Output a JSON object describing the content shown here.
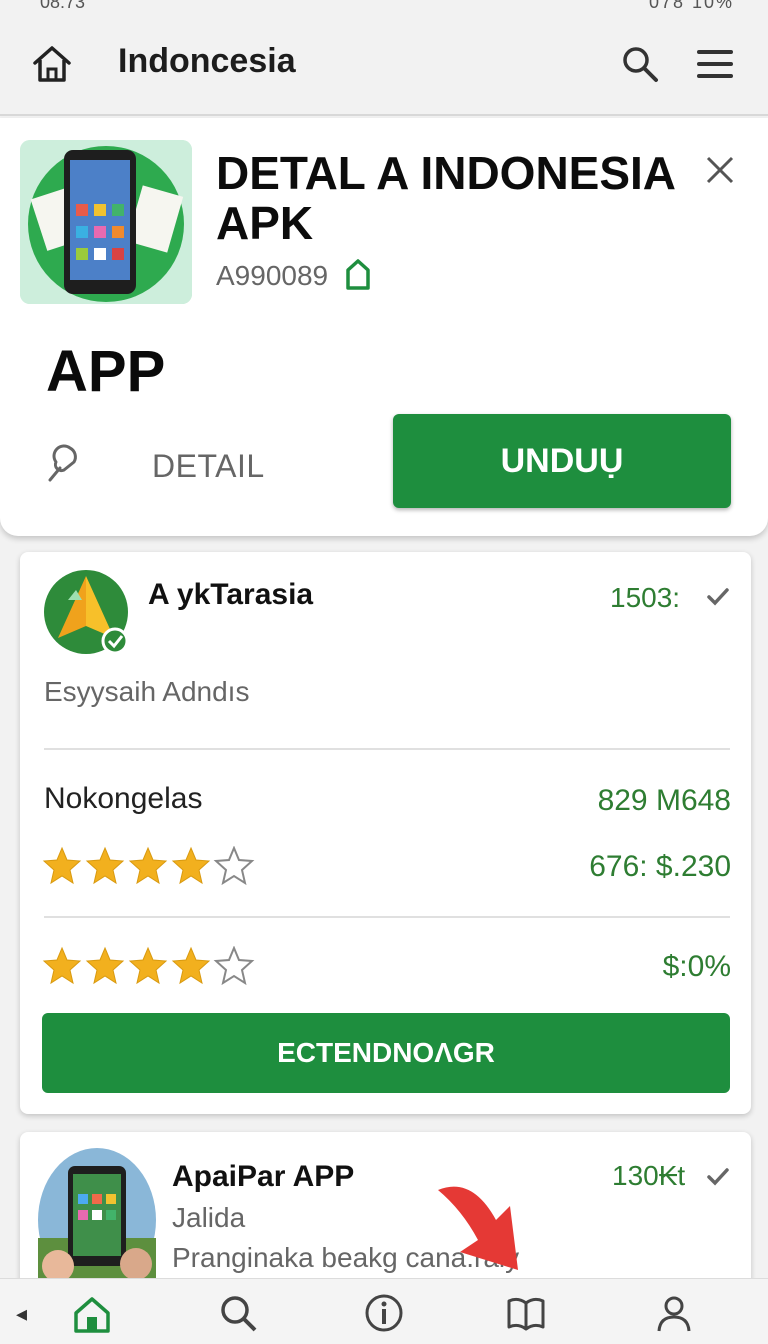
{
  "status": {
    "left": "08:73",
    "right": "078  10%"
  },
  "appbar": {
    "title": "Indoncesia"
  },
  "hero": {
    "app_name": "DETAL A INDONESIA APK",
    "code": "A990089",
    "app_label": "APP",
    "detail_label": "DETAIL",
    "download_label": "UNDUỤ"
  },
  "card": {
    "title": "A ykTarasia",
    "count": "1503:",
    "subtitle": "Esyysaih Adndıs",
    "row_label": "Nokongelas",
    "value1": "829 M648",
    "value2": "676: $.230",
    "value3": "$:0%",
    "rating1": 4,
    "rating2": 4,
    "button_label": "ECTENDNOΛGR"
  },
  "card2": {
    "title": "ApaiPar APP",
    "subtitle": "Jalida",
    "description": "Pranginaka beakg cana.raiy",
    "count": "130₭t"
  },
  "colors": {
    "accent": "#1e8e3e",
    "green_text": "#2e7d32",
    "star": "#f2b01e"
  },
  "icons": [
    "home-icon",
    "search-icon",
    "hamburger-icon",
    "close-icon",
    "link-icon",
    "check-icon",
    "star-icon",
    "info-icon",
    "book-icon",
    "user-icon"
  ]
}
